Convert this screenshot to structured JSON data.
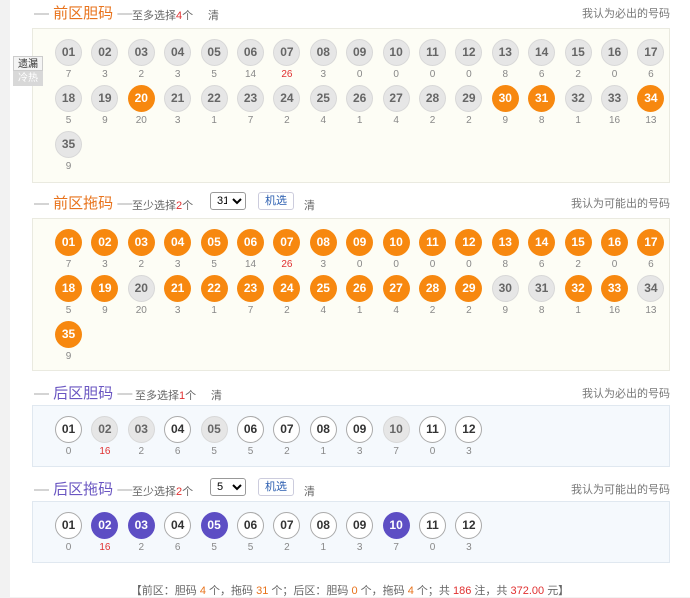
{
  "sections": [
    {
      "key": "fd",
      "side": "front",
      "title": "前区胆码",
      "note_pre": "至多选择",
      "note_num": "4",
      "note_post": "个",
      "clear": "清",
      "hint": "我认为必出的号码",
      "balls": [
        "01",
        "02",
        "03",
        "04",
        "05",
        "06",
        "07",
        "08",
        "09",
        "10",
        "11",
        "12",
        "13",
        "14",
        "15",
        "16",
        "17",
        "18",
        "19",
        "20",
        "21",
        "22",
        "23",
        "24",
        "25",
        "26",
        "27",
        "28",
        "29",
        "30",
        "31",
        "32",
        "33",
        "34",
        "35"
      ],
      "selected": [
        "20",
        "30",
        "31",
        "34"
      ],
      "miss": [
        "7",
        "3",
        "2",
        "3",
        "5",
        "14",
        "26",
        "3",
        "0",
        "0",
        "0",
        "0",
        "8",
        "6",
        "2",
        "0",
        "6",
        "5",
        "9",
        "20",
        "3",
        "1",
        "7",
        "2",
        "4",
        "1",
        "4",
        "2",
        "2",
        "9",
        "8",
        "1",
        "16",
        "13",
        "9"
      ],
      "hot": [
        "07"
      ]
    },
    {
      "key": "ft",
      "side": "front",
      "title": "前区拖码",
      "note_pre": "至少选择",
      "note_num": "2",
      "note_post": "个",
      "select_value": "31",
      "random_label": "机选",
      "clear": "清",
      "hint": "我认为可能出的号码",
      "balls": [
        "01",
        "02",
        "03",
        "04",
        "05",
        "06",
        "07",
        "08",
        "09",
        "10",
        "11",
        "12",
        "13",
        "14",
        "15",
        "16",
        "17",
        "18",
        "19",
        "20",
        "21",
        "22",
        "23",
        "24",
        "25",
        "26",
        "27",
        "28",
        "29",
        "30",
        "31",
        "32",
        "33",
        "34",
        "35"
      ],
      "unselected": [
        "20",
        "30",
        "31",
        "34"
      ],
      "miss": [
        "7",
        "3",
        "2",
        "3",
        "5",
        "14",
        "26",
        "3",
        "0",
        "0",
        "0",
        "0",
        "8",
        "6",
        "2",
        "0",
        "6",
        "5",
        "9",
        "20",
        "3",
        "1",
        "7",
        "2",
        "4",
        "1",
        "4",
        "2",
        "2",
        "9",
        "8",
        "1",
        "16",
        "13",
        "9"
      ],
      "hot": [
        "07"
      ]
    },
    {
      "key": "bd",
      "side": "back",
      "title": "后区胆码",
      "note_pre": "至多选择",
      "note_num": "1",
      "note_post": "个",
      "clear": "清",
      "hint": "我认为必出的号码",
      "balls": [
        "01",
        "02",
        "03",
        "04",
        "05",
        "06",
        "07",
        "08",
        "09",
        "10",
        "11",
        "12"
      ],
      "disabled": [
        "02",
        "03",
        "05",
        "10"
      ],
      "miss": [
        "0",
        "16",
        "2",
        "6",
        "5",
        "5",
        "2",
        "1",
        "3",
        "7",
        "0",
        "3"
      ],
      "hot": [
        "02"
      ]
    },
    {
      "key": "bt",
      "side": "back",
      "title": "后区拖码",
      "note_pre": "至少选择",
      "note_num": "2",
      "note_post": "个",
      "select_value": "5",
      "random_label": "机选",
      "clear": "清",
      "hint": "我认为可能出的号码",
      "balls": [
        "01",
        "02",
        "03",
        "04",
        "05",
        "06",
        "07",
        "08",
        "09",
        "10",
        "11",
        "12"
      ],
      "selected": [
        "02",
        "03",
        "05",
        "10"
      ],
      "miss": [
        "0",
        "16",
        "2",
        "6",
        "5",
        "5",
        "2",
        "1",
        "3",
        "7",
        "0",
        "3"
      ],
      "hot": [
        "02"
      ]
    }
  ],
  "tabs": {
    "a": "遗漏",
    "b": "冷热"
  },
  "summary": {
    "open": "【前区：胆码",
    "fd": "4",
    "t1": "个，拖码",
    "ft": "31",
    "t2": "个；后区：胆码",
    "bd": "0",
    "t3": "个，拖码",
    "bt": "4",
    "t4": "个；共",
    "notes": "186",
    "t5": "注，共",
    "amount": "372.00",
    "t6": "元】"
  },
  "colors": {
    "orange": "#f7880f",
    "purple": "#5d4ec4",
    "grey": "#e6e6e6"
  }
}
